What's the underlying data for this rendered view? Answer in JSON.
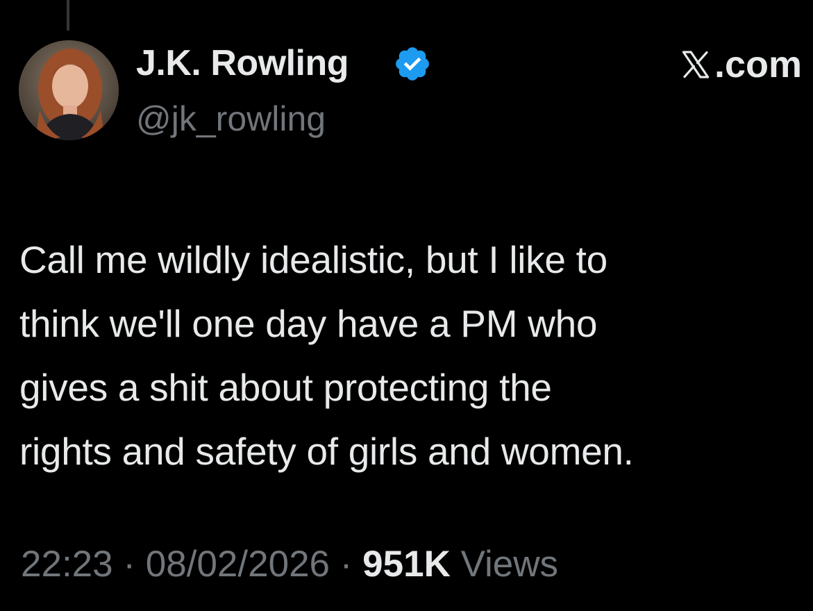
{
  "tweet": {
    "author_name": "J.K. Rowling",
    "author_handle": "@jk_rowling",
    "source_brand": ".com",
    "source_logo_icon": "x-logo-icon",
    "verified_badge_icon": "verified-badge-icon",
    "verified_color": "#1d9bf0",
    "text_lines": [
      "Call me wildly idealistic, but I like to",
      "think we'll one day have a PM who",
      "gives a shit about protecting the",
      "rights and safety of girls and women."
    ],
    "time": "22:23",
    "date": "08/02/2026",
    "separator": "·",
    "views_count": "951K",
    "views_label": "Views"
  }
}
